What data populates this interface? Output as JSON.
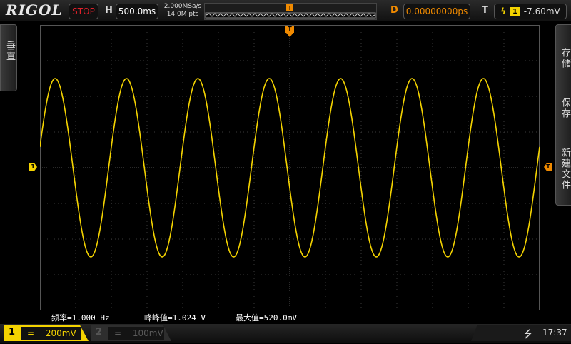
{
  "header": {
    "brand": "RIGOL",
    "run_state": "STOP",
    "horizontal_label": "H",
    "timebase": "500.0ms",
    "sample_rate": "2.000MSa/s",
    "memory_depth": "14.0M pts",
    "delay_label": "D",
    "delay": "0.00000000ps",
    "trigger_label": "T",
    "trigger_source": "1",
    "trigger_level": "-7.60mV"
  },
  "left_menu": {
    "label": "垂直"
  },
  "right_menu": {
    "items": [
      "存储",
      "保存",
      "新建文件"
    ]
  },
  "markers": {
    "channel": "1",
    "trigger": "T"
  },
  "measurements": [
    {
      "label": "频率",
      "value": "1.000 Hz"
    },
    {
      "label": "峰峰值",
      "value": "1.024 V"
    },
    {
      "label": "最大值",
      "value": "520.0mV"
    }
  ],
  "channels": [
    {
      "number": "1",
      "coupling": "=",
      "scale": "200mV",
      "active": true
    },
    {
      "number": "2",
      "coupling": "=",
      "scale": "100mV",
      "active": false
    }
  ],
  "status": {
    "time": "17:37",
    "usb_icon": "usb-icon"
  },
  "colors": {
    "ch1": "#f4d300",
    "trigger": "#f08a00",
    "stop": "#e0202a"
  }
}
